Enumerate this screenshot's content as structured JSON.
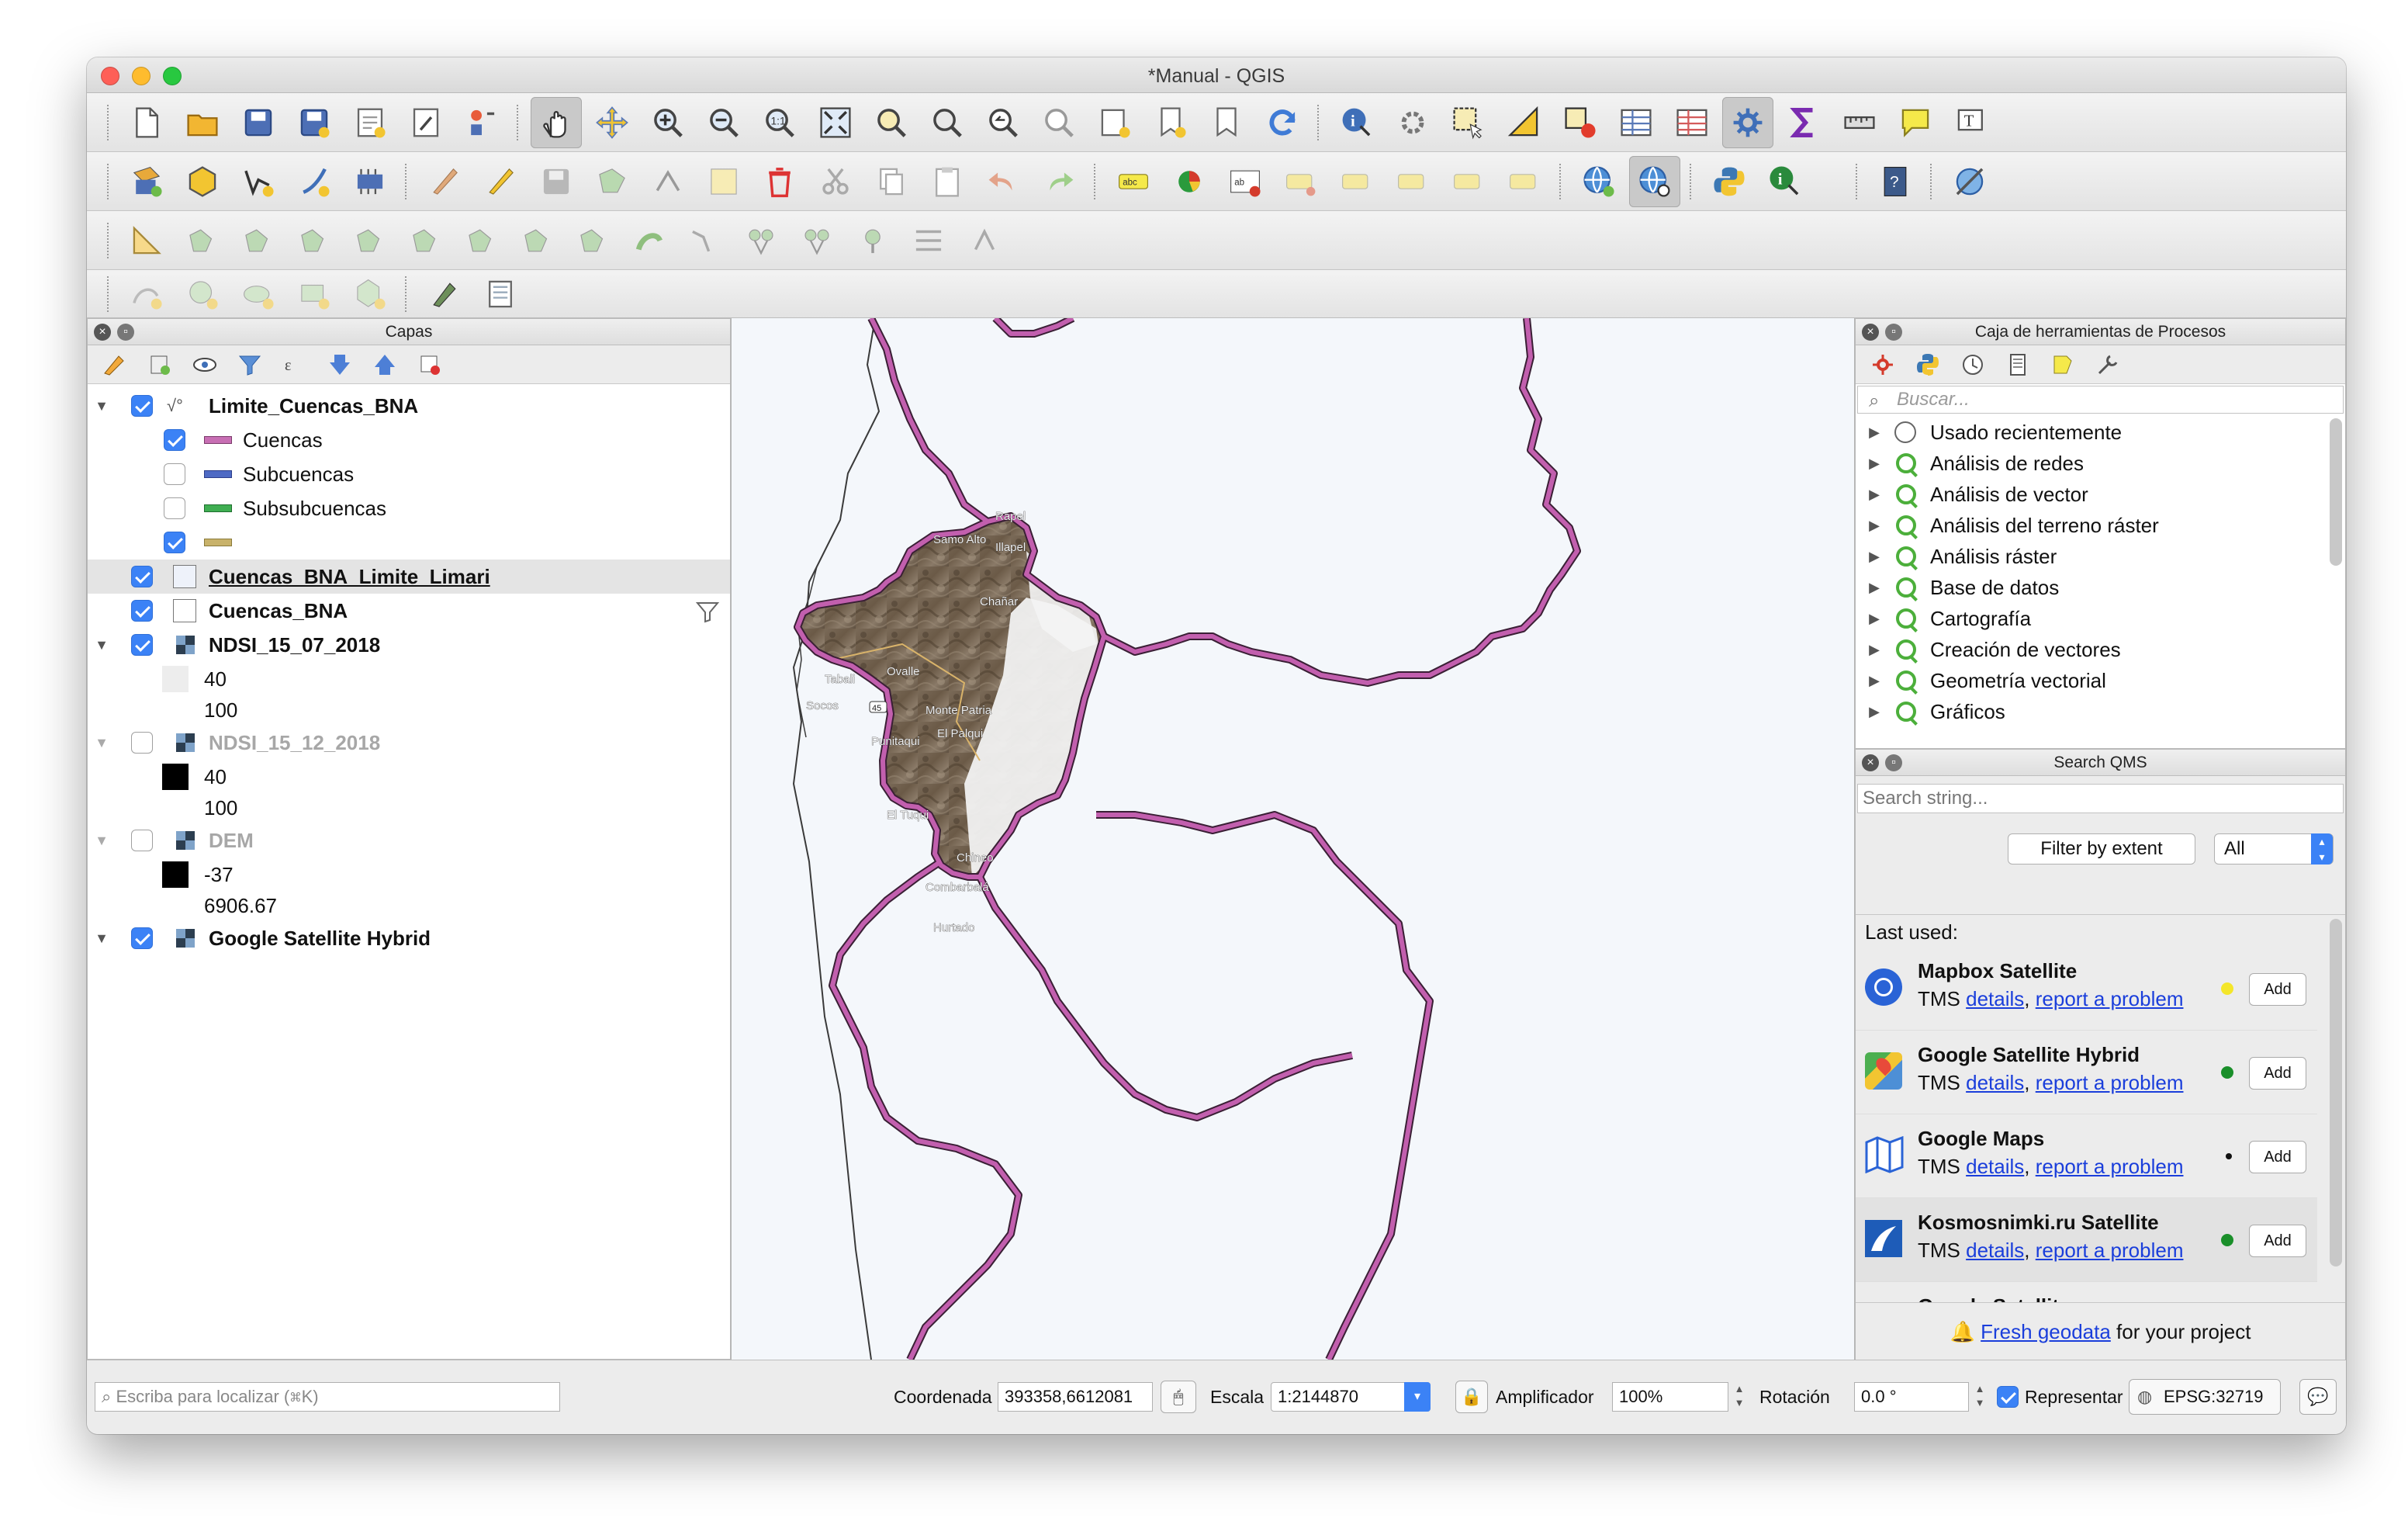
{
  "window": {
    "title": "*Manual - QGIS"
  },
  "layers_panel": {
    "title": "Capas",
    "items": [
      {
        "name": "Limite_Cuencas_BNA",
        "checked": true,
        "expanded": true
      },
      {
        "name": "Cuencas",
        "checked": true,
        "color": "#c86fb4"
      },
      {
        "name": "Subcuencas",
        "checked": false,
        "color": "#4e6ac4"
      },
      {
        "name": "Subsubcuencas",
        "checked": false,
        "color": "#3fae52"
      },
      {
        "name": "",
        "checked": true,
        "color": "#c8b26a"
      },
      {
        "name": "Cuencas_BNA_Limite_Limari",
        "checked": true
      },
      {
        "name": "Cuencas_BNA",
        "checked": true
      },
      {
        "name": "NDSI_15_07_2018",
        "checked": true,
        "expanded": true
      },
      {
        "name": "NDSI_15_12_2018",
        "checked": false,
        "expanded": true
      },
      {
        "name": "DEM",
        "checked": false,
        "expanded": true
      },
      {
        "name": "Google Satellite Hybrid",
        "checked": true,
        "expanded": true
      }
    ],
    "ndsi1_legend": {
      "low": "40",
      "high": "100"
    },
    "ndsi2_legend": {
      "low": "40",
      "high": "100"
    },
    "dem_legend": {
      "low": "-37",
      "high": "6906.67"
    }
  },
  "processing_panel": {
    "title": "Caja de herramientas de Procesos",
    "search_placeholder": "Buscar...",
    "items": [
      "Usado recientemente",
      "Análisis de redes",
      "Análisis de vector",
      "Análisis del terreno ráster",
      "Análisis ráster",
      "Base de datos",
      "Cartografía",
      "Creación de vectores",
      "Geometría vectorial",
      "Gráficos"
    ]
  },
  "qms_panel": {
    "title": "Search QMS",
    "search_placeholder": "Search string...",
    "filter_button": "Filter by extent",
    "filter_select": "All",
    "last_used": "Last used:",
    "results": [
      {
        "name": "Mapbox Satellite",
        "type": "TMS",
        "details": "details",
        "report": "report a problem",
        "add": "Add",
        "status_color": "#f4e62a"
      },
      {
        "name": "Google Satellite Hybrid",
        "type": "TMS",
        "details": "details",
        "report": "report a problem",
        "add": "Add",
        "status_color": "#1a8f2a"
      },
      {
        "name": "Google Maps",
        "type": "TMS",
        "details": "details",
        "report": "report a problem",
        "add": "Add",
        "status_color": "#111111"
      },
      {
        "name": "Kosmosnimki.ru Satellite",
        "type": "TMS",
        "details": "details",
        "report": "report a problem",
        "add": "Add",
        "status_color": "#1a8f2a"
      },
      {
        "name": "Google Satellite"
      }
    ],
    "footer_link": "Fresh geodata",
    "footer_text": " for your project"
  },
  "map": {
    "place_labels": [
      "Samo Alto",
      "Ovalle",
      "Tabali",
      "Socos",
      "Monte Patria",
      "El Palqui",
      "Punitaqui",
      "El Tuqui",
      "Chineo",
      "Combarbalá",
      "Hurtado",
      "Chañar",
      "Rapel",
      "Illapel"
    ],
    "road_label": "45"
  },
  "status_bar": {
    "locator_placeholder": "Escriba para localizar (⌘K)",
    "coord_label": "Coordenada",
    "coord_value": "393358,6612081",
    "scale_label": "Escala",
    "scale_value": "1:2144870",
    "magnifier_label": "Amplificador",
    "magnifier_value": "100%",
    "rotation_label": "Rotación",
    "rotation_value": "0.0 °",
    "render_label": "Representar",
    "crs": "EPSG:32719"
  },
  "colors": {
    "basin_outline": "#c25fae",
    "accent": "#3b82f6",
    "qgis_green": "#4caf3b"
  }
}
